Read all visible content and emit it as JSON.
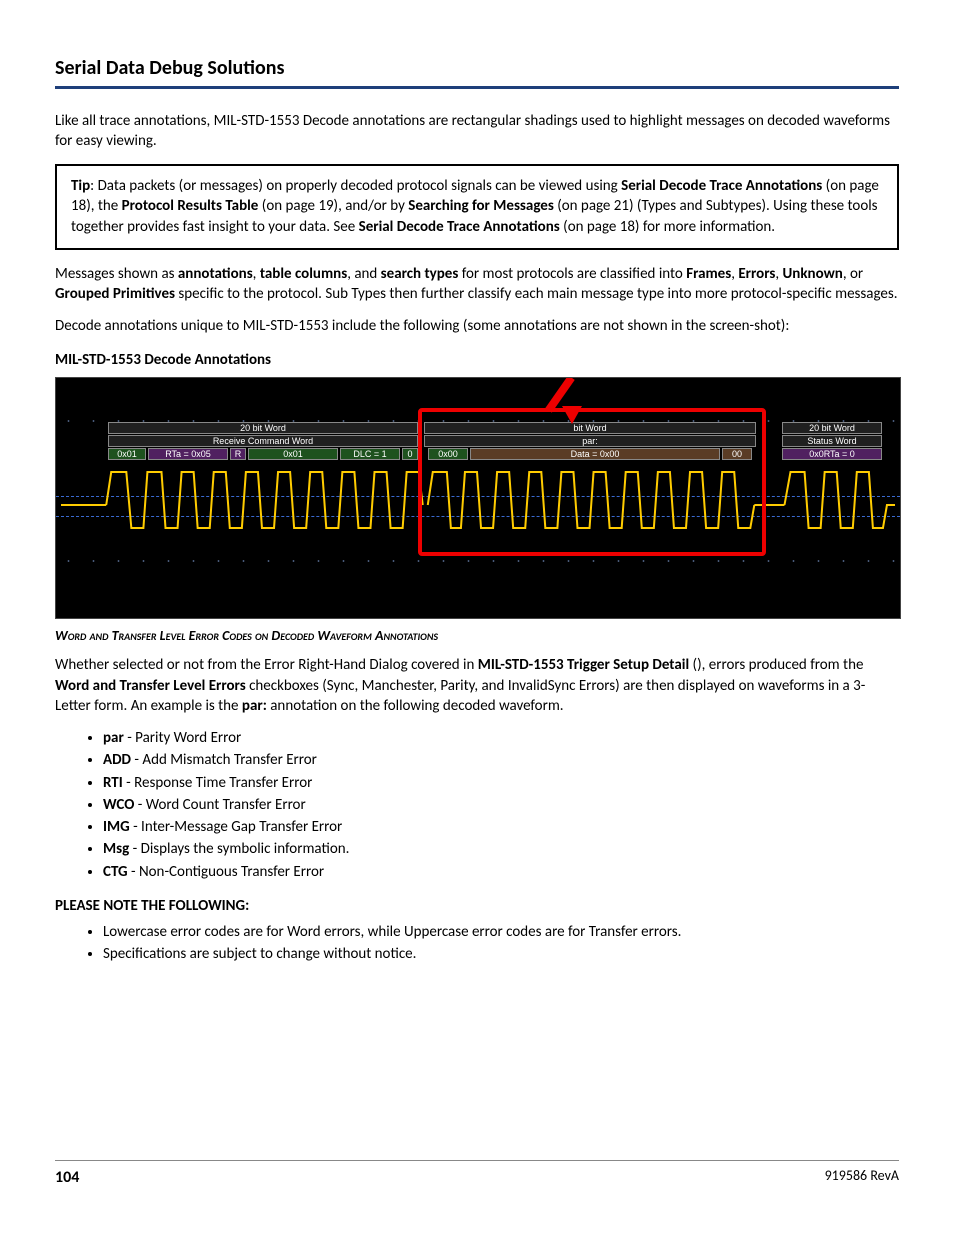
{
  "header": {
    "title": "Serial Data Debug Solutions"
  },
  "intro": "Like all trace annotations, MIL-STD-1553 Decode annotations are rectangular shadings used to highlight messages on decoded waveforms for easy viewing.",
  "tip": {
    "label": "Tip",
    "body1": ": Data packets (or messages) on properly decoded protocol signals can be viewed using ",
    "b1": "Serial Decode Trace Annotations",
    "body2": " (on page 18), the ",
    "b2": "Protocol Results Table",
    "body3": " (on page 19), and/or by ",
    "b3": "Searching for Messages",
    "body4": " (on page 21) (Types and Subtypes). Using these tools together provides fast insight to your data. See ",
    "b4": "Serial Decode Trace Annotations",
    "body5": " (on page 18) for more information."
  },
  "para2a": "Messages shown as ",
  "para2b1": "annotations",
  "para2b": ", ",
  "para2b2": "table columns",
  "para2c": ", and ",
  "para2b3": "search types",
  "para2d": " for most protocols are classified into ",
  "para2b4": "Frames",
  "para2e": ", ",
  "para2b5": "Errors",
  "para2f": ", ",
  "para2b6": "Unknown",
  "para2g": ", or ",
  "para2b7": "Grouped Primitives",
  "para2h": " specific to the protocol. Sub Types then further classify each main message type into more protocol-specific messages.",
  "para3": "Decode annotations unique to MIL-STD-1553 include the following (some annotations are not shown in the screen-shot):",
  "subhead1": "MIL-STD-1553 Decode Annotations",
  "figure": {
    "word1": "20 bit Word",
    "word1_sub": "Receive Command Word",
    "word2_top": "bit Word",
    "word2_sub": "par:",
    "word3": "20 bit Word",
    "word3_sub": "Status Word",
    "v1": "0x01",
    "v2": "RTa = 0x05",
    "v3": "R",
    "v4": "0x01",
    "v5": "DLC = 1",
    "v6": "0",
    "v7": "0x00",
    "v8": "Data = 0x00",
    "v9": "00",
    "v10": "0x0RTa = 0"
  },
  "caption": "Word and Transfer Level Error Codes on Decoded Waveform Annotations",
  "para4a": "Whether selected or not from the Error Right-Hand Dialog covered in ",
  "para4b": "MIL-STD-1553 Trigger Setup Detail",
  "para4c": " (), errors produced from the ",
  "para4d": "Word and Transfer Level Errors",
  "para4e": " checkboxes (Sync, Manchester, Parity, and InvalidSync Errors) are then displayed on waveforms in a 3-Letter form. An example is the ",
  "para4f": "par:",
  "para4g": " annotation on the following decoded waveform.",
  "errors": [
    {
      "code": "par",
      "desc": " - Parity Word Error"
    },
    {
      "code": "ADD",
      "desc": " - Add Mismatch Transfer Error"
    },
    {
      "code": "RTI",
      "desc": " - Response Time Transfer Error"
    },
    {
      "code": "WCO",
      "desc": " - Word Count Transfer Error"
    },
    {
      "code": "IMG",
      "desc": " - Inter-Message Gap Transfer Error"
    },
    {
      "code": "Msg",
      "desc": " - Displays the symbolic information."
    },
    {
      "code": "CTG",
      "desc": " - Non-Contiguous Transfer Error"
    }
  ],
  "note_head": "PLEASE NOTE THE FOLLOWING",
  "notes": [
    "Lowercase error codes are for Word errors, while Uppercase error codes are for Transfer errors.",
    "Specifications are subject to change without notice."
  ],
  "footer": {
    "page": "104",
    "rev": "919586 RevA"
  }
}
